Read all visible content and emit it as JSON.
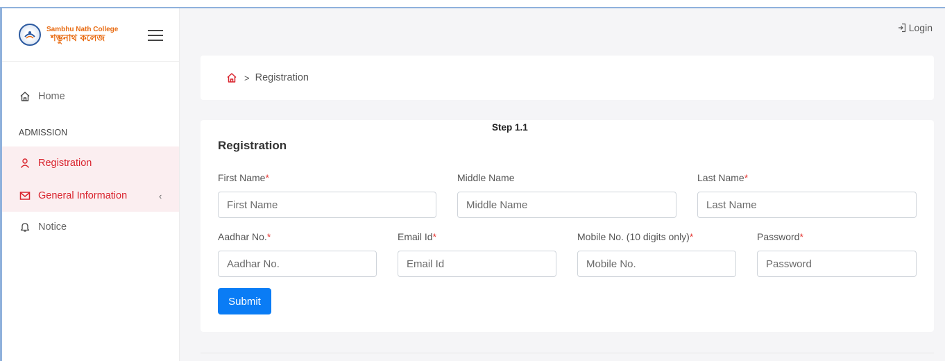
{
  "brand": {
    "name_en": "Sambhu Nath College",
    "name_bn": "শম্ভুনাথ কলেজ"
  },
  "header": {
    "login_label": "Login"
  },
  "sidebar": {
    "home_label": "Home",
    "section_label": "ADMISSION",
    "registration_label": "Registration",
    "general_info_label": "General Information",
    "notice_label": "Notice"
  },
  "breadcrumb": {
    "current": "Registration"
  },
  "form": {
    "step": "Step 1.1",
    "title": "Registration",
    "first_name": {
      "label": "First Name",
      "placeholder": "First Name",
      "required_mark": "*"
    },
    "middle_name": {
      "label": "Middle Name",
      "placeholder": "Middle Name"
    },
    "last_name": {
      "label": "Last Name",
      "placeholder": "Last Name",
      "required_mark": "*"
    },
    "aadhar": {
      "label": "Aadhar No.",
      "placeholder": "Aadhar No.",
      "required_mark": "*"
    },
    "email": {
      "label": "Email Id",
      "placeholder": "Email Id",
      "required_mark": "*"
    },
    "mobile": {
      "label": "Mobile No. (10 digits only)",
      "placeholder": "Mobile No.",
      "required_mark": "*"
    },
    "password": {
      "label": "Password",
      "placeholder": "Password",
      "required_mark": "*"
    },
    "submit_label": "Submit"
  },
  "colors": {
    "accent": "#d9232d",
    "primary_button": "#0a7cf5",
    "active_bg": "#fbeef0",
    "brand_orange": "#e86a10"
  }
}
